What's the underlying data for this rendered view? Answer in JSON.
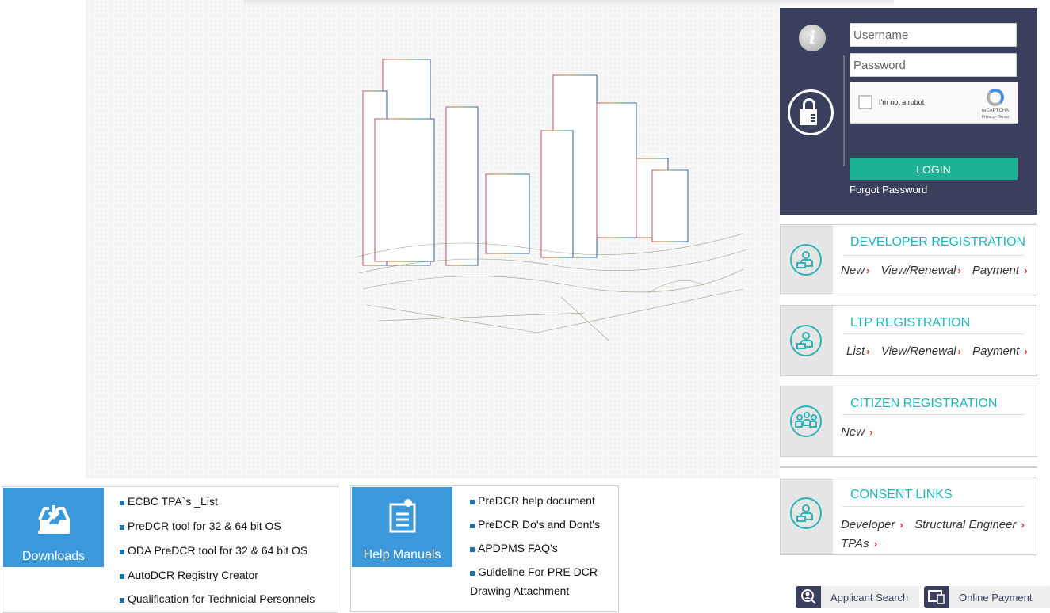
{
  "login": {
    "username_placeholder": "Username",
    "password_placeholder": "Password",
    "captcha_label": "I'm not a robot",
    "captcha_brand": "reCAPTCHA",
    "captcha_terms": "Privacy - Terms",
    "login_button": "LOGIN",
    "forgot_password": "Forgot Password"
  },
  "cards": {
    "developer": {
      "title": "DEVELOPER REGISTRATION",
      "links": [
        "New",
        "View/Renewal",
        "Payment"
      ]
    },
    "ltp": {
      "title": "LTP REGISTRATION",
      "links": [
        "List",
        "View/Renewal",
        "Payment"
      ]
    },
    "citizen": {
      "title": "CITIZEN REGISTRATION",
      "links": [
        "New"
      ]
    },
    "consent": {
      "title": "CONSENT LINKS",
      "links": [
        "Developer",
        "Structural Engineer",
        "TPAs"
      ]
    }
  },
  "downloads": {
    "label": "Downloads",
    "items": [
      "ECBC TPA`s _List",
      "PreDCR tool for 32 & 64 bit OS",
      "ODA PreDCR tool for 32 & 64 bit OS",
      "AutoDCR Registry Creator",
      "Qualification for Technicial Personnels"
    ]
  },
  "help_manuals": {
    "label": "Help Manuals",
    "items": [
      "PreDCR help document",
      "PreDCR Do's and Dont's",
      "APDPMS FAQ’s",
      "Guideline For PRE DCR",
      "Drawing Attachment"
    ]
  },
  "quick_links": {
    "applicant_search": "Applicant Search",
    "online_payment": "Online Payment"
  },
  "colors": {
    "login_panel": "#3a3f5e",
    "login_button": "#1ab394",
    "card_title": "#1fb5b8",
    "tile_blue": "#3a98db",
    "chevron_red": "#e53935"
  },
  "chevron": "›"
}
